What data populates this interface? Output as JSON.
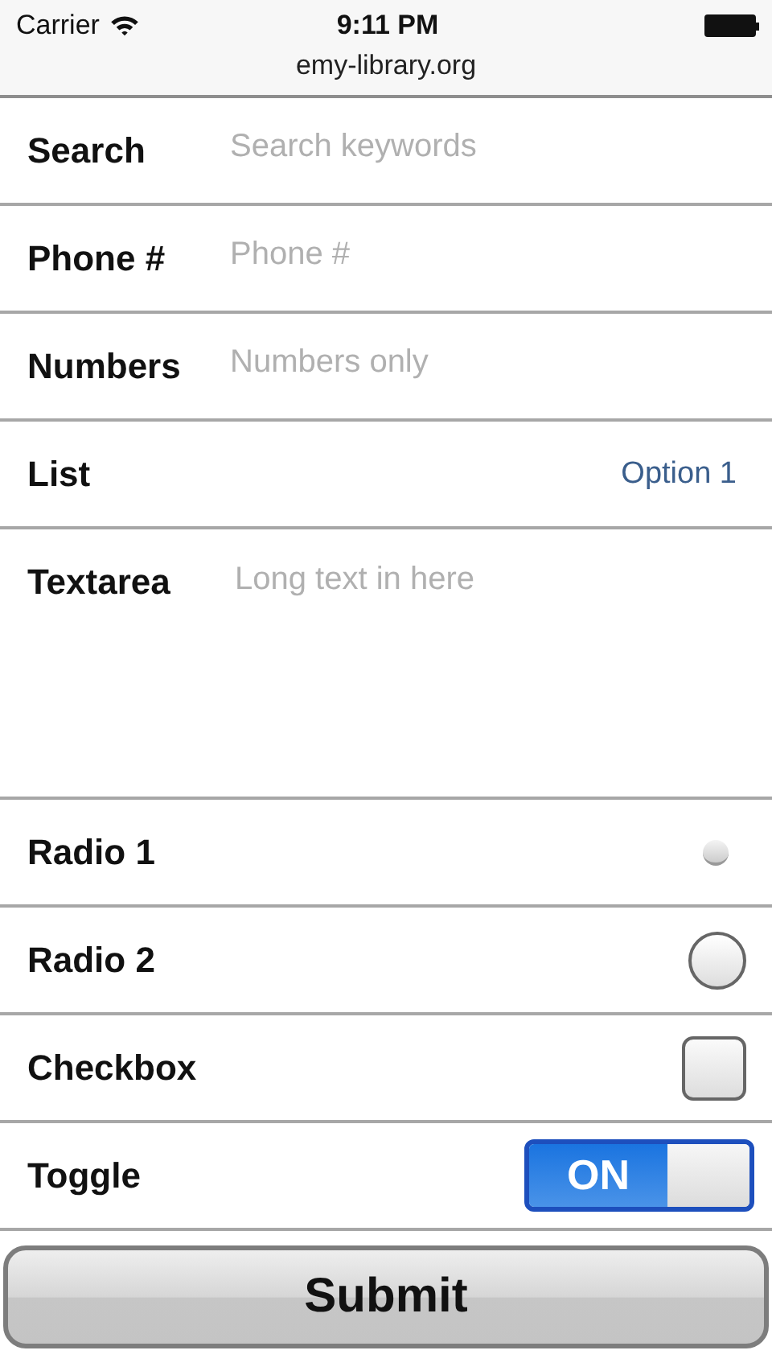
{
  "status_bar": {
    "carrier": "Carrier",
    "time": "9:11 PM",
    "url": "emy-library.org"
  },
  "fields": [
    {
      "kind": "text",
      "label": "Search",
      "placeholder": "Search keywords"
    },
    {
      "kind": "text",
      "label": "Phone #",
      "placeholder": "Phone #"
    },
    {
      "kind": "text",
      "label": "Numbers",
      "placeholder": "Numbers only"
    },
    {
      "kind": "select",
      "label": "List",
      "value": "Option 1"
    },
    {
      "kind": "textarea",
      "label": "Textarea",
      "placeholder": "Long text in here"
    },
    {
      "kind": "radio-small",
      "label": "Radio 1",
      "selected": false
    },
    {
      "kind": "radio",
      "label": "Radio 2",
      "selected": false
    },
    {
      "kind": "checkbox",
      "label": "Checkbox",
      "checked": false
    },
    {
      "kind": "toggle",
      "label": "Toggle",
      "on": true,
      "state_label": "ON"
    }
  ],
  "submit": {
    "label": "Submit"
  }
}
